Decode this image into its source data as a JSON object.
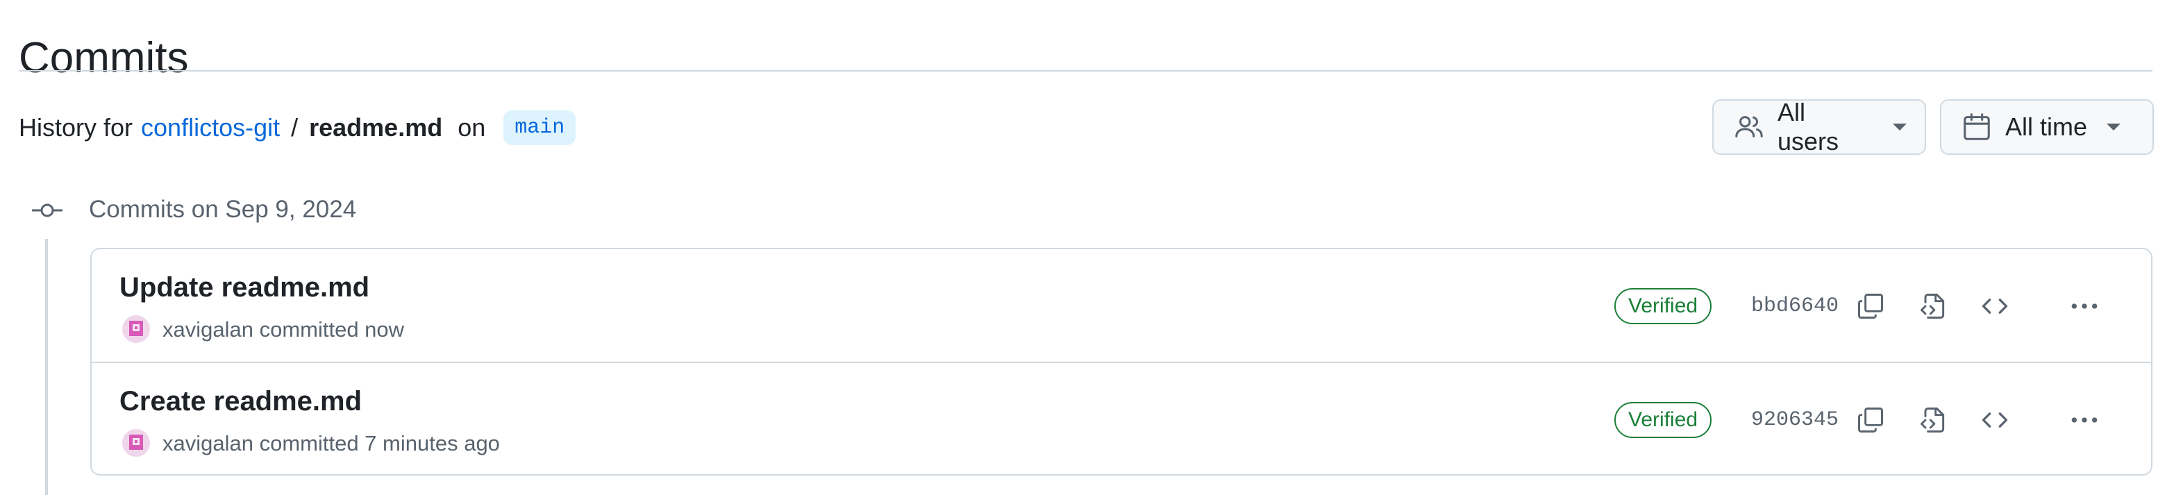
{
  "page": {
    "title": "Commits"
  },
  "history": {
    "prefix": "History for",
    "repo": "conflictos-git",
    "separator": "/",
    "file": "readme.md",
    "on": "on",
    "branch": "main"
  },
  "filters": {
    "users_label": "All users",
    "time_label": "All time"
  },
  "group": {
    "heading": "Commits on Sep 9, 2024"
  },
  "commits": [
    {
      "title": "Update readme.md",
      "author": "xavigalan",
      "meta": "xavigalan committed now",
      "badge": "Verified",
      "sha": "bbd6640"
    },
    {
      "title": "Create readme.md",
      "author": "xavigalan",
      "meta": "xavigalan committed 7 minutes ago",
      "badge": "Verified",
      "sha": "9206345"
    }
  ],
  "colors": {
    "link": "#0969da",
    "verified": "#1a7f37",
    "muted": "#59636e",
    "border": "#d1d9e0"
  },
  "icons": {
    "users_filter": "people-icon",
    "time_filter": "calendar-icon",
    "group": "git-commit-icon",
    "copy": "copy-icon",
    "browse_file": "file-code-icon",
    "browse_code": "code-icon",
    "more": "kebab-horizontal-icon"
  }
}
